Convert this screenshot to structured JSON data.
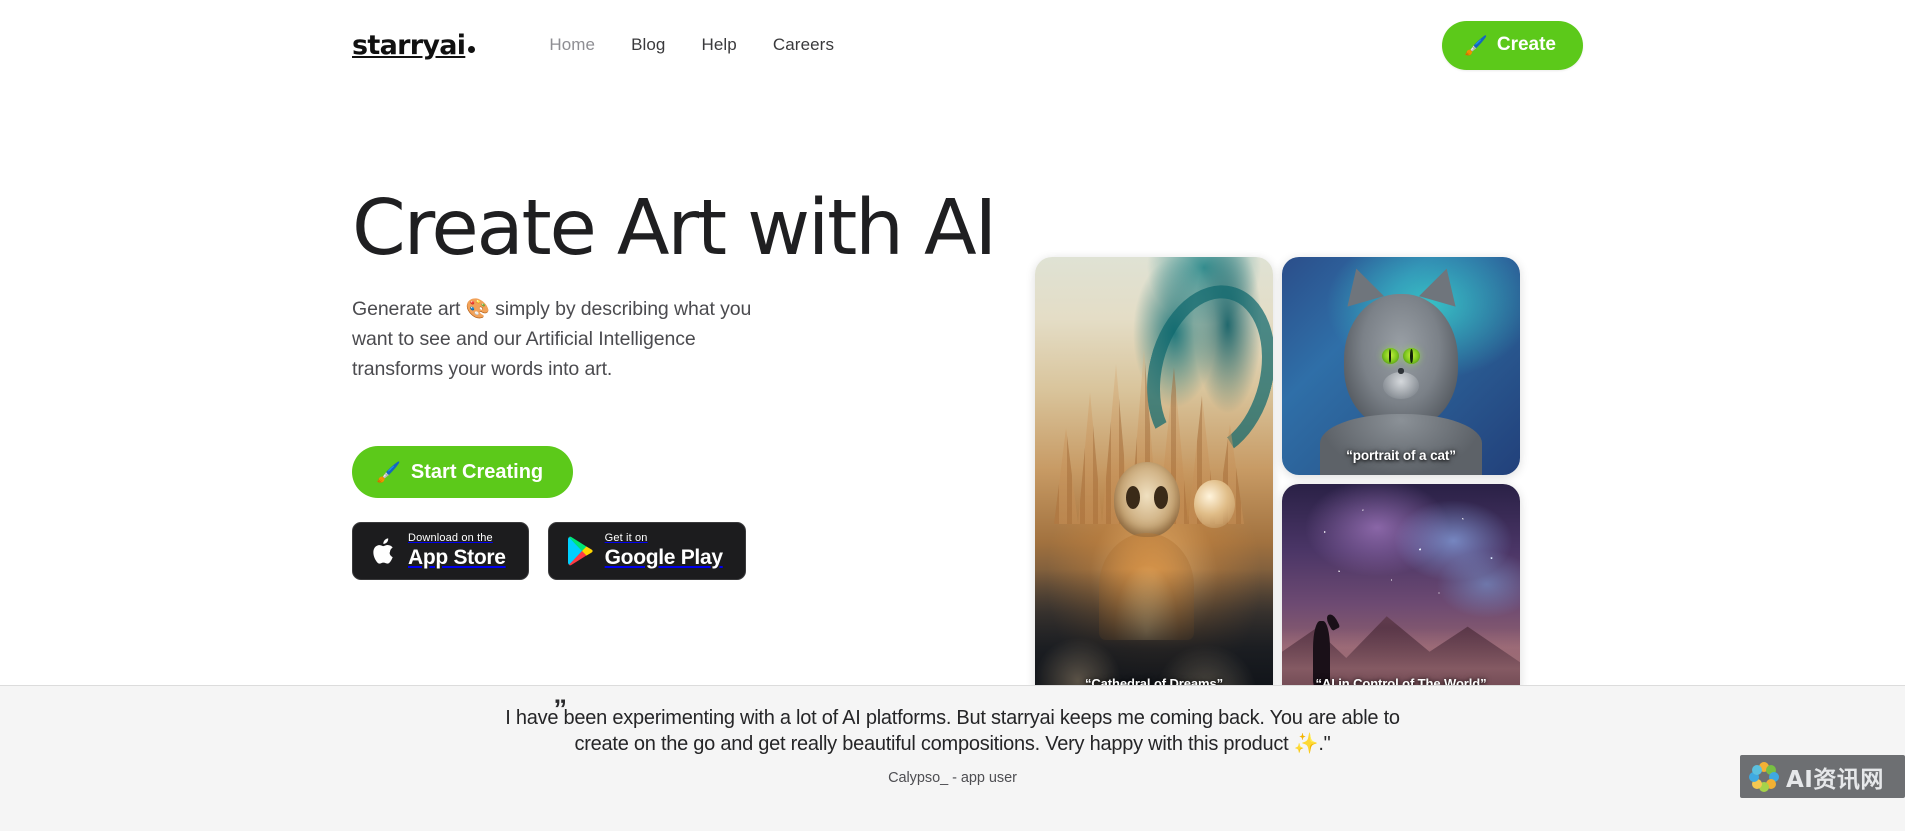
{
  "brand": {
    "logo_text": "starryai",
    "logo_mark": "dot"
  },
  "nav": {
    "links": [
      {
        "label": "Home",
        "active": true
      },
      {
        "label": "Blog",
        "active": false
      },
      {
        "label": "Help",
        "active": false
      },
      {
        "label": "Careers",
        "active": false
      }
    ],
    "create_button": {
      "label": "Create",
      "icon": "paintbrush-emoji",
      "icon_glyph": "🖌️",
      "color": "#5cc91a"
    }
  },
  "hero": {
    "title": "Create Art with AI",
    "subtitle_part1": "Generate art ",
    "subtitle_emoji": "🎨",
    "subtitle_part2": " simply by describing what you want to see and our Artificial Intelligence transforms your words into art.",
    "cta": {
      "label": "Start Creating",
      "icon": "paintbrush-emoji",
      "icon_glyph": "🖌️",
      "color": "#5cc91a"
    },
    "stores": [
      {
        "small_label": "Download on the",
        "big_label": "App Store",
        "icon": "apple-icon"
      },
      {
        "small_label": "Get it on",
        "big_label": "Google Play",
        "icon": "google-play-icon"
      }
    ]
  },
  "gallery": {
    "cards": [
      {
        "caption": "“Cathedral of Dreams”",
        "art": "cathedral",
        "size": "tall"
      },
      {
        "caption": "“portrait of a cat”",
        "art": "cat",
        "size": "small"
      },
      {
        "caption": "“AI in Control of The World”",
        "art": "nebula",
        "size": "small"
      }
    ]
  },
  "testimonial": {
    "quote_mark": "”",
    "quote": "I have been experimenting with a lot of AI platforms. But starryai keeps me coming back. You are able to create on the go and get really beautiful compositions. Very happy with this product ✨.\"",
    "author": "Calypso_ - app user"
  },
  "watermark": {
    "text": "AI资讯网",
    "icon": "flower-logo-icon",
    "background": "#5a5c60"
  },
  "theme": {
    "accent_green": "#5cc91a",
    "page_background": "#ffffff",
    "testimonial_background": "#f5f5f5",
    "badge_background": "#1c1c1e"
  }
}
